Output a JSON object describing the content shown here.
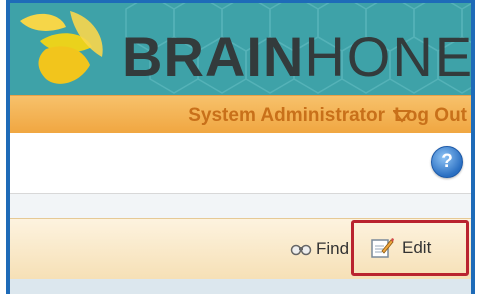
{
  "brand": {
    "part1": "BRAIN",
    "part2": "HONEY",
    "tm": "™",
    "colors": {
      "banner": "#3ea2a8",
      "text": "#333b3c"
    }
  },
  "userbar": {
    "user": "System Administrator",
    "logout": "Log Out",
    "color": "#c8701a"
  },
  "toolbar": {
    "help_label": "?"
  },
  "actions": {
    "find": "Find",
    "edit": "Edit"
  },
  "icons": [
    "bee-logo-icon",
    "caret-down-icon",
    "help-icon",
    "binoculars-icon",
    "edit-icon"
  ]
}
